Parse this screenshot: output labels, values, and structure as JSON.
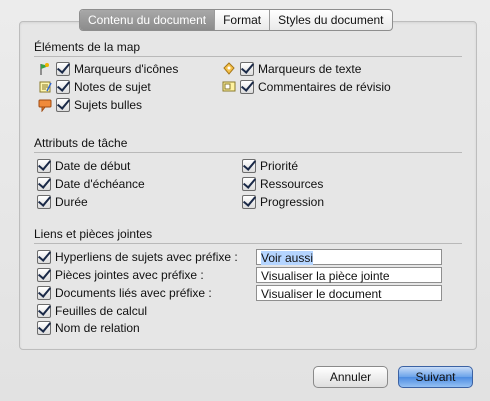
{
  "tabs": [
    "Contenu du document",
    "Format",
    "Styles du document"
  ],
  "sections": {
    "map": {
      "title": "Éléments de la map",
      "items": [
        {
          "label": "Marqueurs d'icônes",
          "checked": true,
          "icon": "flag-marker-icon"
        },
        {
          "label": "Notes de sujet",
          "checked": true,
          "icon": "note-icon"
        },
        {
          "label": "Sujets bulles",
          "checked": true,
          "icon": "callout-icon"
        },
        {
          "label": "Marqueurs de texte",
          "checked": true,
          "icon": "text-marker-icon"
        },
        {
          "label": "Commentaires de révisio",
          "checked": true,
          "icon": "comment-icon"
        }
      ]
    },
    "task": {
      "title": "Attributs de tâche",
      "items": [
        {
          "label": "Date de début",
          "checked": true
        },
        {
          "label": "Date d'échéance",
          "checked": true
        },
        {
          "label": "Durée",
          "checked": true
        },
        {
          "label": "Priorité",
          "checked": true
        },
        {
          "label": "Ressources",
          "checked": true
        },
        {
          "label": "Progression",
          "checked": true
        }
      ]
    },
    "links": {
      "title": "Liens et pièces jointes",
      "items": [
        {
          "label": "Hyperliens de sujets avec préfixe :",
          "checked": true,
          "field": "Voir aussi"
        },
        {
          "label": "Pièces jointes avec préfixe :",
          "checked": true,
          "field": "Visualiser la pièce jointe"
        },
        {
          "label": "Documents liés avec préfixe :",
          "checked": true,
          "field": "Visualiser le document"
        },
        {
          "label": "Feuilles de calcul",
          "checked": true
        },
        {
          "label": "Nom de relation",
          "checked": true
        }
      ]
    }
  },
  "buttons": {
    "cancel": "Annuler",
    "next": "Suivant"
  },
  "colors": {
    "accent": "#4d8ce2",
    "selection": "#b5d5ff"
  }
}
